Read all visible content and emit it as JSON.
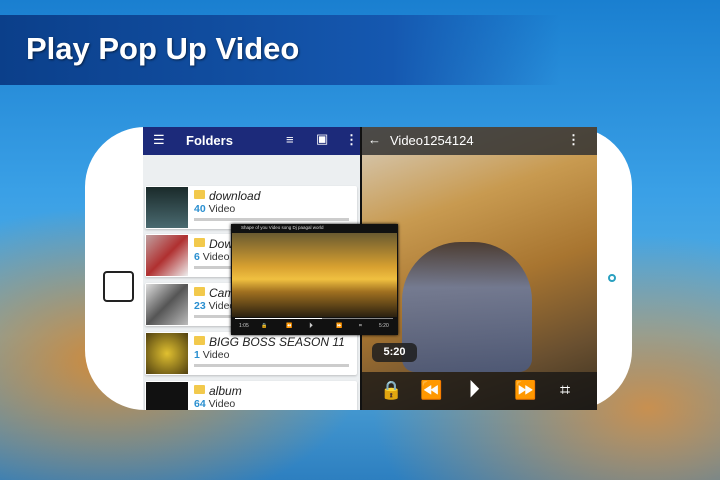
{
  "banner": {
    "title": "Play Pop Up Video"
  },
  "folders": {
    "title": "Folders",
    "items": [
      {
        "name": "download",
        "count": "40",
        "unit": "Video"
      },
      {
        "name": "Down",
        "count": "6",
        "unit": "Video"
      },
      {
        "name": "Cam",
        "count": "23",
        "unit": "Video"
      },
      {
        "name": "BIGG BOSS SEASON 11",
        "count": "1",
        "unit": "Video"
      },
      {
        "name": "album",
        "count": "64",
        "unit": "Video"
      }
    ]
  },
  "popup": {
    "title": "Shape of you Video song Dj paagal world",
    "elapsed": "1:05",
    "remaining": "5:20",
    "progress": 0.55
  },
  "player": {
    "title": "Video1254124",
    "time": "5:20"
  },
  "colors": {
    "toolbar": "#1c2a7a",
    "accent": "#2a8fd0",
    "folder": "#f2c94c"
  }
}
